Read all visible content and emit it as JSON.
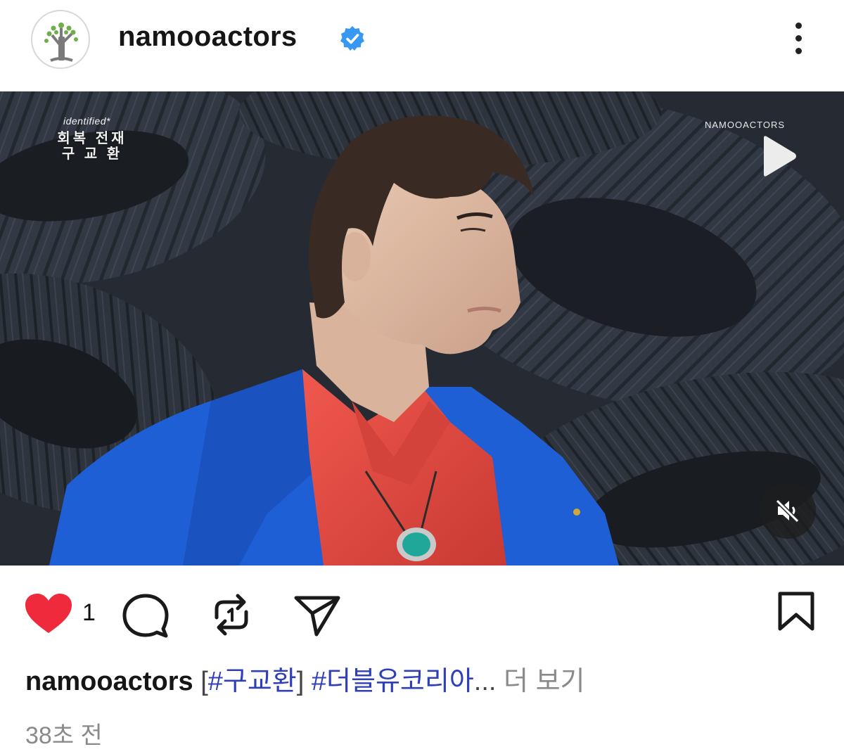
{
  "post": {
    "username": "namooactors",
    "verified": true,
    "media": {
      "badge": "identified*",
      "show_title_line1": "회복 전재",
      "show_title_line2": "구 교 환",
      "watermark": "NAMOOACTORS"
    },
    "likes_count": "1",
    "caption": {
      "username": "namooactors",
      "bracket_open": "[",
      "tag1": "#구교환",
      "bracket_close": "]",
      "tag2": "#더블유코리아",
      "ellipsis": "...",
      "more_label": "더 보기"
    },
    "timestamp": "38초 전"
  },
  "icons": {
    "like": "heart-icon",
    "comment": "comment-icon",
    "repost": "repost-icon",
    "share": "send-icon",
    "save": "bookmark-icon",
    "more": "more-vertical-icon",
    "play": "play-icon",
    "mute": "muted-speaker-icon",
    "verified": "verified-badge-icon"
  },
  "colors": {
    "like_red": "#ee2a3c",
    "verified_blue": "#3897f0",
    "hashtag_blue": "#2f3fb8",
    "muted_gray": "#8a8a8a"
  }
}
